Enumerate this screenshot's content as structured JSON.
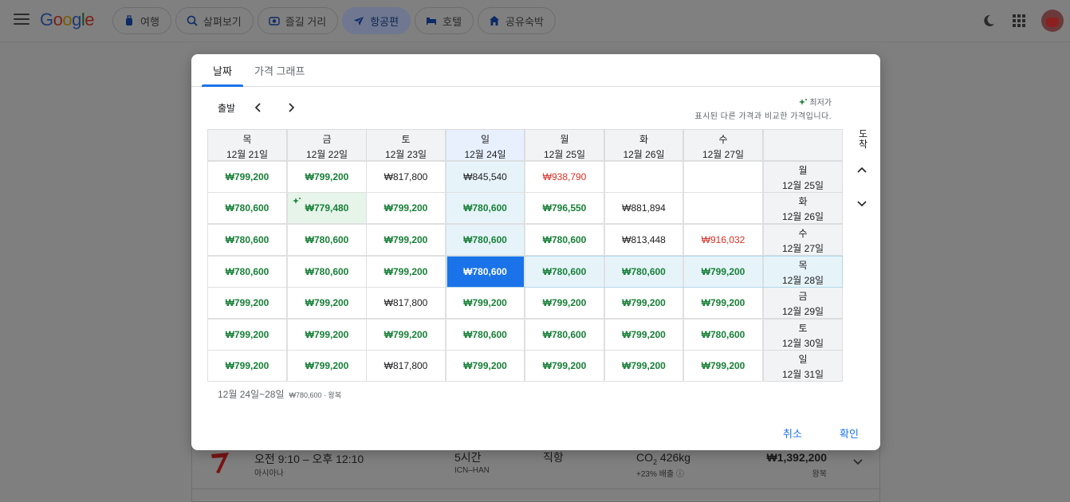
{
  "topbar": {
    "logo": "Google",
    "chips": [
      {
        "label": "여행",
        "icon": "luggage-icon",
        "active": false
      },
      {
        "label": "살펴보기",
        "icon": "explore-icon",
        "active": false
      },
      {
        "label": "즐길 거리",
        "icon": "camera-icon",
        "active": false
      },
      {
        "label": "항공편",
        "icon": "airplane-icon",
        "active": true
      },
      {
        "label": "호텔",
        "icon": "bed-icon",
        "active": false
      },
      {
        "label": "공유숙박",
        "icon": "house-icon",
        "active": false
      }
    ]
  },
  "background_flight": {
    "depart": "오전 9:10",
    "separator": "–",
    "arrive": "오후 12:10",
    "airline": "아시아나",
    "duration": "5시간",
    "route": "ICN–HAN",
    "stops": "직항",
    "co2_value": "426kg",
    "co2_label": "CO",
    "co2_sub": "2",
    "co2_delta": "+23% 배출",
    "price": "₩1,392,200",
    "trip_type": "왕복"
  },
  "dialog": {
    "tabs": [
      {
        "label": "날짜",
        "active": true
      },
      {
        "label": "가격 그래프",
        "active": false
      }
    ],
    "departure_label": "출발",
    "arrival_label": "도착",
    "legend_title": "최저가",
    "legend_subtitle": "표시된 다른 가격과 비교한 가격입니다.",
    "summary_dates": "12월 24일~28일",
    "summary_price": "₩780,600 · 왕복",
    "cancel_label": "취소",
    "confirm_label": "확인",
    "columns": [
      {
        "dow": "목",
        "date": "12월 21일"
      },
      {
        "dow": "금",
        "date": "12월 22일"
      },
      {
        "dow": "토",
        "date": "12월 23일"
      },
      {
        "dow": "일",
        "date": "12월 24일"
      },
      {
        "dow": "월",
        "date": "12월 25일"
      },
      {
        "dow": "화",
        "date": "12월 26일"
      },
      {
        "dow": "수",
        "date": "12월 27일"
      }
    ],
    "rows": [
      {
        "dow": "월",
        "date": "12월 25일",
        "cells": [
          {
            "v": "₩799,200",
            "c": "g"
          },
          {
            "v": "₩799,200",
            "c": "g"
          },
          {
            "v": "₩817,800",
            "c": "n"
          },
          {
            "v": "₩845,540",
            "c": "n"
          },
          {
            "v": "₩938,790",
            "c": "r"
          },
          {
            "v": "",
            "c": "n"
          },
          {
            "v": "",
            "c": "n"
          }
        ]
      },
      {
        "dow": "화",
        "date": "12월 26일",
        "cells": [
          {
            "v": "₩780,600",
            "c": "g"
          },
          {
            "v": "₩779,480",
            "c": "g",
            "best": true
          },
          {
            "v": "₩799,200",
            "c": "g"
          },
          {
            "v": "₩780,600",
            "c": "g"
          },
          {
            "v": "₩796,550",
            "c": "g"
          },
          {
            "v": "₩881,894",
            "c": "n"
          },
          {
            "v": "",
            "c": "n"
          }
        ]
      },
      {
        "dow": "수",
        "date": "12월 27일",
        "cells": [
          {
            "v": "₩780,600",
            "c": "g"
          },
          {
            "v": "₩780,600",
            "c": "g"
          },
          {
            "v": "₩799,200",
            "c": "g"
          },
          {
            "v": "₩780,600",
            "c": "g"
          },
          {
            "v": "₩780,600",
            "c": "g"
          },
          {
            "v": "₩813,448",
            "c": "n"
          },
          {
            "v": "₩916,032",
            "c": "r"
          }
        ]
      },
      {
        "dow": "목",
        "date": "12월 28일",
        "cells": [
          {
            "v": "₩780,600",
            "c": "g"
          },
          {
            "v": "₩780,600",
            "c": "g"
          },
          {
            "v": "₩799,200",
            "c": "g"
          },
          {
            "v": "₩780,600",
            "c": "g",
            "picked": true
          },
          {
            "v": "₩780,600",
            "c": "g"
          },
          {
            "v": "₩780,600",
            "c": "g"
          },
          {
            "v": "₩799,200",
            "c": "g"
          }
        ]
      },
      {
        "dow": "금",
        "date": "12월 29일",
        "cells": [
          {
            "v": "₩799,200",
            "c": "g"
          },
          {
            "v": "₩799,200",
            "c": "g"
          },
          {
            "v": "₩817,800",
            "c": "n"
          },
          {
            "v": "₩799,200",
            "c": "g"
          },
          {
            "v": "₩799,200",
            "c": "g"
          },
          {
            "v": "₩799,200",
            "c": "g"
          },
          {
            "v": "₩799,200",
            "c": "g"
          }
        ]
      },
      {
        "dow": "토",
        "date": "12월 30일",
        "cells": [
          {
            "v": "₩799,200",
            "c": "g"
          },
          {
            "v": "₩799,200",
            "c": "g"
          },
          {
            "v": "₩799,200",
            "c": "g"
          },
          {
            "v": "₩780,600",
            "c": "g"
          },
          {
            "v": "₩780,600",
            "c": "g"
          },
          {
            "v": "₩799,200",
            "c": "g"
          },
          {
            "v": "₩780,600",
            "c": "g"
          }
        ]
      },
      {
        "dow": "일",
        "date": "12월 31일",
        "cells": [
          {
            "v": "₩799,200",
            "c": "g"
          },
          {
            "v": "₩799,200",
            "c": "g"
          },
          {
            "v": "₩817,800",
            "c": "n"
          },
          {
            "v": "₩799,200",
            "c": "g"
          },
          {
            "v": "₩799,200",
            "c": "g"
          },
          {
            "v": "₩799,200",
            "c": "g"
          },
          {
            "v": "₩799,200",
            "c": "g"
          }
        ]
      }
    ],
    "selected_column_index": 3,
    "selected_row_index": 3
  },
  "colors": {
    "accent": "#1a73e8",
    "price_low": "#188038",
    "price_high": "#d93025"
  }
}
